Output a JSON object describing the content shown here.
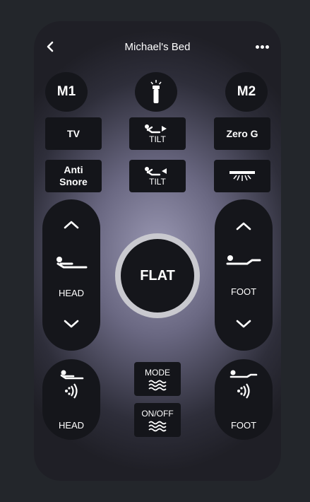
{
  "header": {
    "title": "Michael's Bed",
    "back_icon": "chevron-left-icon",
    "more_icon": "more-dots-icon"
  },
  "memory": {
    "m1_label": "M1",
    "m2_label": "M2",
    "light_icon": "flashlight-icon"
  },
  "presets": {
    "tv_label": "TV",
    "tilt_up_label": "TILT",
    "zero_g_label": "Zero G",
    "anti_snore_line1": "Anti",
    "anti_snore_line2": "Snore",
    "tilt_down_label": "TILT",
    "underbed_light_icon": "underbed-light-icon"
  },
  "head_control": {
    "label": "HEAD"
  },
  "foot_control": {
    "label": "FOOT"
  },
  "flat_label": "FLAT",
  "massage": {
    "head_label": "HEAD",
    "foot_label": "FOOT",
    "mode_label": "MODE",
    "onoff_label": "ON/OFF"
  },
  "colors": {
    "background": "#23262b",
    "button": "#14151a",
    "ring": "#c9c9cf"
  }
}
